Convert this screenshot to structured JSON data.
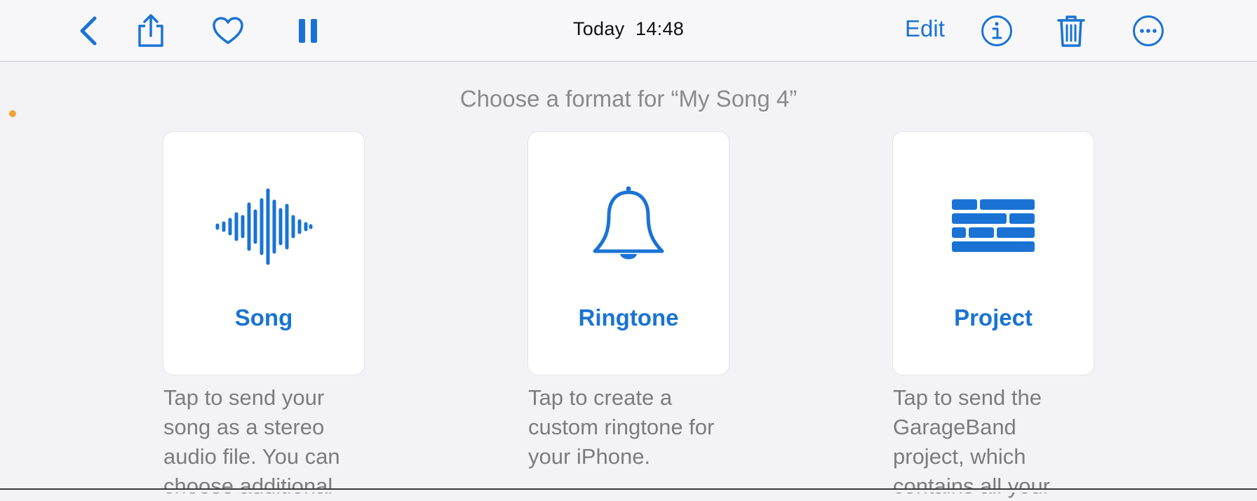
{
  "toolbar": {
    "title": "Today  14:48",
    "edit_label": "Edit",
    "icons": [
      "chevron-left-icon",
      "share-icon",
      "heart-icon",
      "pause-icon",
      "info-icon",
      "trash-icon",
      "more-icon"
    ]
  },
  "main": {
    "heading": "Choose a format for “My Song 4”",
    "options": [
      {
        "label": "Song",
        "icon": "waveform-icon",
        "description": "Tap to send your song as a stereo audio file. You can choose additional"
      },
      {
        "label": "Ringtone",
        "icon": "bell-icon",
        "description": "Tap to create a custom ringtone for your iPhone."
      },
      {
        "label": "Project",
        "icon": "bricks-icon",
        "description": "Tap to send the GarageBand project, which contains all your"
      }
    ]
  },
  "colors": {
    "accent": "#1a73d4",
    "background": "#f2f2f7",
    "secondary_text": "#7c7c80"
  }
}
